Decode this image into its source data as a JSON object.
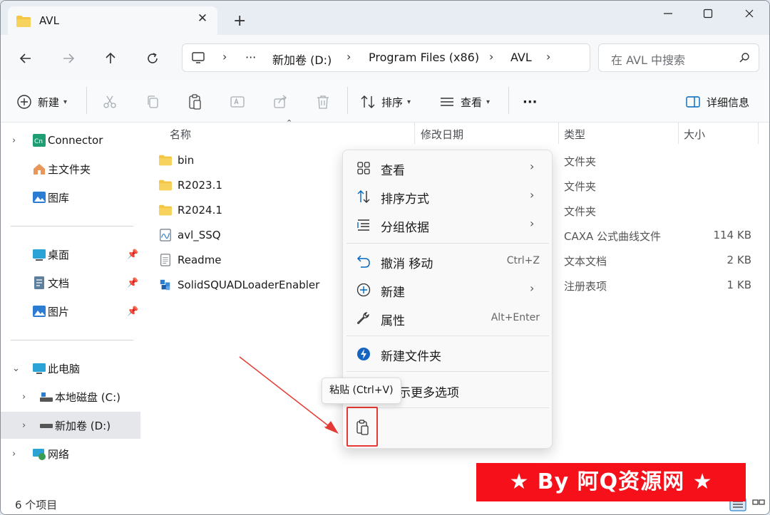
{
  "window": {
    "tab_title": "AVL",
    "tab_close": "✕",
    "new_tab": "+"
  },
  "addressbar": {
    "overflow": "···",
    "crumbs": [
      "新加卷 (D:)",
      "Program Files (x86)",
      "AVL"
    ],
    "chevron": "›"
  },
  "search": {
    "placeholder": "在 AVL 中搜索"
  },
  "commandbar": {
    "new_label": "新建",
    "sort_label": "排序",
    "view_label": "查看",
    "more_label": "···",
    "details_label": "详细信息"
  },
  "sidebar": {
    "items": [
      {
        "label": "Connector"
      },
      {
        "label": "主文件夹"
      },
      {
        "label": "图库"
      },
      {
        "label": "桌面"
      },
      {
        "label": "文档"
      },
      {
        "label": "图片"
      },
      {
        "label": "此电脑"
      },
      {
        "label": "本地磁盘 (C:)"
      },
      {
        "label": "新加卷 (D:)"
      },
      {
        "label": "网络"
      }
    ]
  },
  "filelist": {
    "headers": {
      "name": "名称",
      "modified": "修改日期",
      "type": "类型",
      "size": "大小"
    },
    "rows": [
      {
        "name": "bin",
        "type": "文件夹",
        "size": ""
      },
      {
        "name": "R2023.1",
        "type": "文件夹",
        "size": ""
      },
      {
        "name": "R2024.1",
        "type": "文件夹",
        "size": ""
      },
      {
        "name": "avl_SSQ",
        "type": "CAXA 公式曲线文件",
        "size": "114 KB"
      },
      {
        "name": "Readme",
        "type": "文本文档",
        "size": "2 KB"
      },
      {
        "name": "SolidSQUADLoaderEnabler",
        "type": "注册表项",
        "size": "1 KB"
      }
    ]
  },
  "context_menu": {
    "view": "查看",
    "sort_by": "排序方式",
    "group_by": "分组依据",
    "undo": "撤消 移动",
    "undo_key": "Ctrl+Z",
    "new": "新建",
    "properties": "属性",
    "properties_key": "Alt+Enter",
    "new_folder": "新建文件夹",
    "more_options": "示更多选项",
    "submenu_arrow": "›"
  },
  "tooltip": {
    "text": "粘贴 (Ctrl+V)"
  },
  "status": {
    "count": "6 个项目"
  },
  "watermark": {
    "text": "★ By 阿Q资源网 ★"
  },
  "colors": {
    "accent": "#0067c0",
    "folder": "#f3c744",
    "highlight_red": "#e53935",
    "banner_red": "#f5101a"
  }
}
